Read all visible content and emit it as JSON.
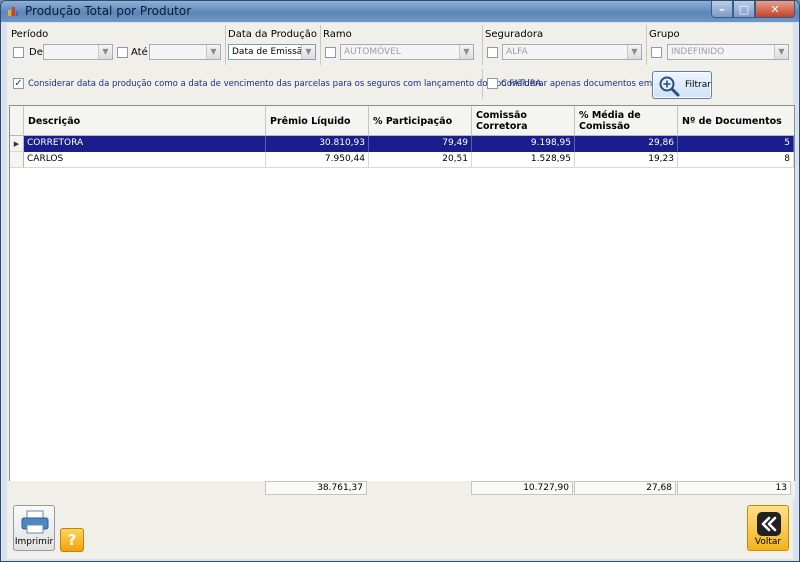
{
  "window": {
    "title": "Produção Total por Produtor",
    "min_glyph": "–",
    "max_glyph": "□",
    "close_glyph": "✕"
  },
  "filters": {
    "periodo": {
      "label": "Período",
      "de_label": "De",
      "ate_label": "Até",
      "de_checked": false,
      "ate_checked": false
    },
    "data_producao": {
      "label": "Data da Produção",
      "value": "Data de Emissão"
    },
    "ramo": {
      "label": "Ramo",
      "value": "AUTOMÓVEL",
      "checked": false
    },
    "seguradora": {
      "label": "Seguradora",
      "value": "ALFA",
      "checked": false
    },
    "grupo": {
      "label": "Grupo",
      "value": "INDEFINIDO",
      "checked": false
    },
    "considerar_fatura": {
      "label": "Considerar data da produção como a data de vencimento das parcelas para os seguros com lançamento do tipo FATURA.",
      "checked": true
    },
    "apenas_emitidos": {
      "label": "Considerar apenas documentos emitidos",
      "checked": false
    },
    "filtrar_button": "Filtrar"
  },
  "grid": {
    "columns": [
      {
        "h1": "Descrição",
        "h2": ""
      },
      {
        "h1": "Prêmio Líquido",
        "h2": ""
      },
      {
        "h1": "% Participação",
        "h2": ""
      },
      {
        "h1": "Comissão",
        "h2": "Corretora"
      },
      {
        "h1": "% Média de",
        "h2": "Comissão"
      },
      {
        "h1": "Nº de Documentos",
        "h2": ""
      }
    ],
    "rows": [
      {
        "descricao": "CORRETORA",
        "premio": "30.810,93",
        "participacao": "79,49",
        "comissao": "9.198,95",
        "media": "29,86",
        "documentos": "5",
        "selected": true
      },
      {
        "descricao": "CARLOS",
        "premio": "7.950,44",
        "participacao": "20,51",
        "comissao": "1.528,95",
        "media": "19,23",
        "documentos": "8",
        "selected": false
      }
    ],
    "totals": {
      "premio": "38.761,37",
      "comissao": "10.727,90",
      "media": "27,68",
      "documentos": "13"
    }
  },
  "buttons": {
    "imprimir": "Imprimir",
    "help": "?",
    "voltar": "Voltar"
  },
  "colors": {
    "selection": "#1a1e8c",
    "voltar_accent": "#f4b31d",
    "help_accent": "#f0a30a"
  }
}
